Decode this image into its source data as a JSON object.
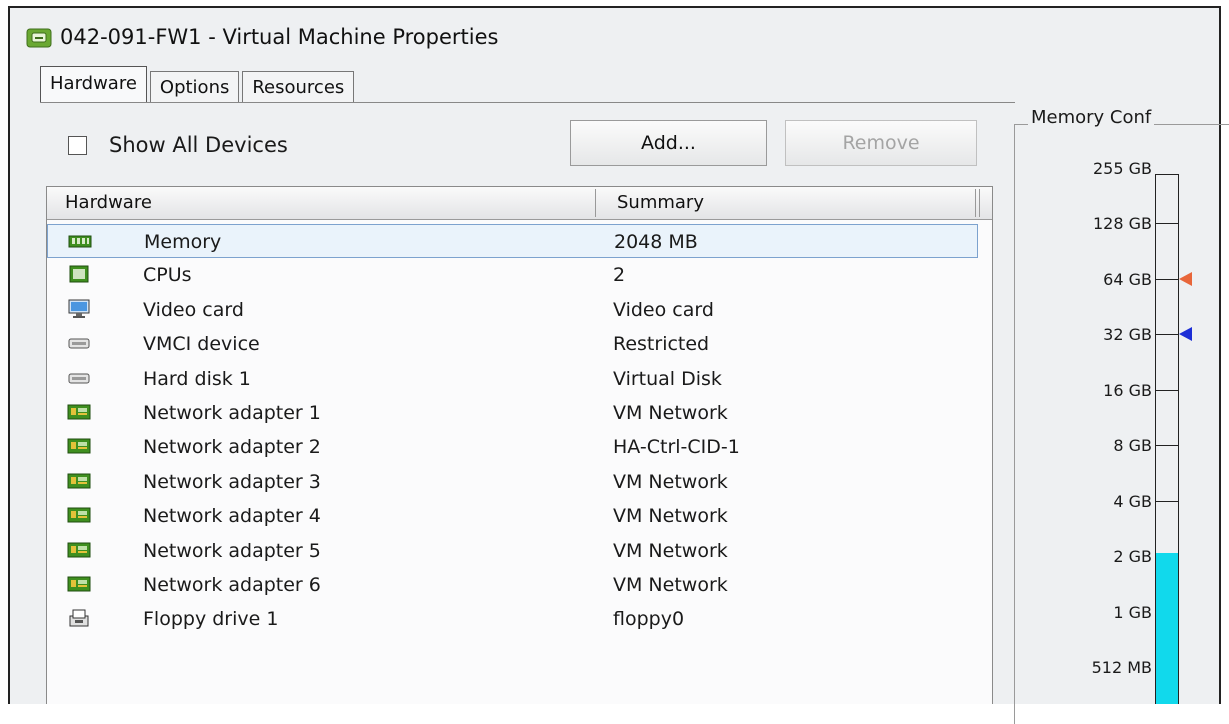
{
  "window": {
    "title": "042-091-FW1 - Virtual Machine Properties"
  },
  "tabs": [
    {
      "label": "Hardware",
      "active": true
    },
    {
      "label": "Options",
      "active": false
    },
    {
      "label": "Resources",
      "active": false
    }
  ],
  "toolbar": {
    "show_all_label": "Show All Devices",
    "show_all_checked": false,
    "add_label": "Add...",
    "remove_label": "Remove",
    "remove_enabled": false
  },
  "table": {
    "headers": {
      "hardware": "Hardware",
      "summary": "Summary"
    },
    "rows": [
      {
        "name": "Memory",
        "summary": "2048 MB",
        "icon": "memory-icon",
        "selected": true
      },
      {
        "name": "CPUs",
        "summary": "2",
        "icon": "cpu-icon"
      },
      {
        "name": "Video card",
        "summary": "Video card",
        "icon": "monitor-icon"
      },
      {
        "name": "VMCI device",
        "summary": "Restricted",
        "icon": "device-icon"
      },
      {
        "name": "Hard disk 1",
        "summary": "Virtual Disk",
        "icon": "disk-icon"
      },
      {
        "name": "Network adapter 1",
        "summary": "VM Network",
        "icon": "network-adapter-icon"
      },
      {
        "name": "Network adapter 2",
        "summary": "HA-Ctrl-CID-1",
        "icon": "network-adapter-icon"
      },
      {
        "name": "Network adapter 3",
        "summary": "VM Network",
        "icon": "network-adapter-icon"
      },
      {
        "name": "Network adapter 4",
        "summary": "VM Network",
        "icon": "network-adapter-icon"
      },
      {
        "name": "Network adapter 5",
        "summary": "VM Network",
        "icon": "network-adapter-icon"
      },
      {
        "name": "Network adapter 6",
        "summary": "VM Network",
        "icon": "network-adapter-icon"
      },
      {
        "name": "Floppy drive 1",
        "summary": "floppy0",
        "icon": "floppy-icon"
      }
    ]
  },
  "memory_config": {
    "title": "Memory Conf",
    "scale_labels": [
      "255 GB",
      "128 GB",
      "64 GB",
      "32 GB",
      "16 GB",
      "8 GB",
      "4 GB",
      "2 GB",
      "1 GB",
      "512 MB"
    ],
    "current_value": "2048 MB",
    "markers": [
      {
        "name": "orange-marker",
        "at": "64 GB",
        "color": "#e8663a"
      },
      {
        "name": "blue-marker",
        "at": "32 GB",
        "color": "#1c2ed6"
      }
    ],
    "fill_color": "#11d9ec"
  },
  "colors": {
    "selection": "#eaf3fb",
    "selection_border": "#7da2ce"
  }
}
